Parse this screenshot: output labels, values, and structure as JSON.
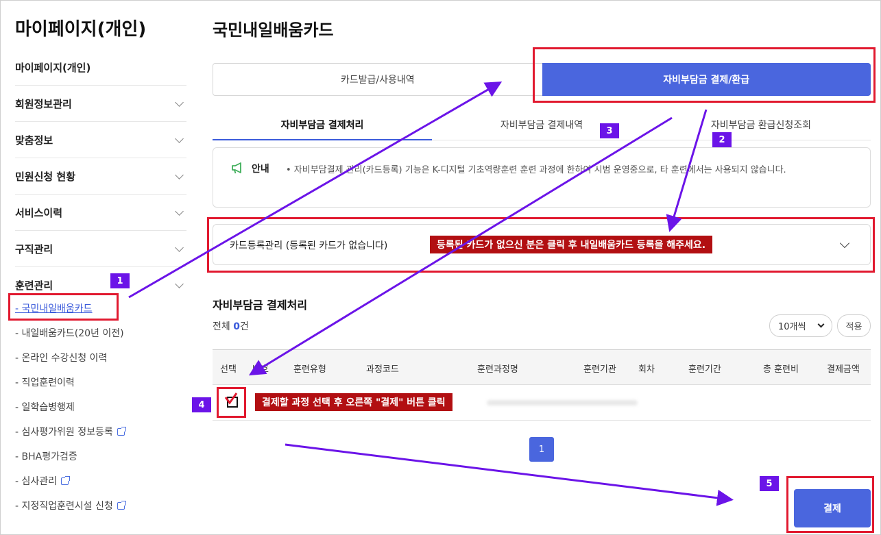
{
  "sidebar": {
    "title": "마이페이지(개인)",
    "items": [
      {
        "label": "마이페이지(개인)",
        "chevron": false
      },
      {
        "label": "회원정보관리",
        "chevron": true
      },
      {
        "label": "맞춤정보",
        "chevron": true
      },
      {
        "label": "민원신청 현황",
        "chevron": true
      },
      {
        "label": "서비스이력",
        "chevron": true
      },
      {
        "label": "구직관리",
        "chevron": true
      },
      {
        "label": "훈련관리",
        "chevron": true
      }
    ],
    "sub_items": [
      {
        "label": "- 국민내일배움카드",
        "active": true,
        "external": false
      },
      {
        "label": "- 내일배움카드(20년 이전)",
        "active": false,
        "external": false
      },
      {
        "label": "- 온라인 수강신청 이력",
        "active": false,
        "external": false
      },
      {
        "label": "- 직업훈련이력",
        "active": false,
        "external": false
      },
      {
        "label": "- 일학습병행제",
        "active": false,
        "external": false
      },
      {
        "label": "- 심사평가위원 정보등록",
        "active": false,
        "external": true
      },
      {
        "label": "- BHA평가검증",
        "active": false,
        "external": false
      },
      {
        "label": "- 심사관리",
        "active": false,
        "external": true
      },
      {
        "label": "- 지정직업훈련시설 신청",
        "active": false,
        "external": true
      }
    ]
  },
  "main": {
    "title": "국민내일배움카드",
    "tabs": [
      {
        "label": "카드발급/사용내역",
        "active": false
      },
      {
        "label": "자비부담금 결제/환급",
        "active": true
      }
    ],
    "subtabs": [
      {
        "label": "자비부담금 결제처리",
        "active": true
      },
      {
        "label": "자비부담금 결제내역",
        "active": false
      },
      {
        "label": "자비부담금 환급신청조회",
        "active": false
      }
    ],
    "notice": {
      "label": "안내",
      "text": "• 자비부담결제 관리(카드등록) 기능은 K-디지털 기초역량훈련 훈련 과정에 한하여 시범 운영중으로, 타 훈련에서는 사용되지 않습니다."
    },
    "card_register": {
      "label": "카드등록관리 (등록된 카드가 없습니다)"
    },
    "section_title": "자비부담금 결제처리",
    "total_prefix": "전체 ",
    "total_count": "0",
    "total_suffix": "건",
    "page_size": "10개씩",
    "apply_label": "적용",
    "table_headers": [
      "선택",
      "번호",
      "훈련유형",
      "과정코드",
      "훈련과정명",
      "훈련기관",
      "회차",
      "훈련기간",
      "총 훈련비",
      "결제금액"
    ],
    "page_number": "1",
    "pay_label": "결제"
  },
  "annotations": {
    "step1": "1",
    "step2": "2",
    "step3": "3",
    "step4": "4",
    "step5": "5",
    "banner_card": "등록된 카드가 없으신 분은 클릭 후 내일배움카드 등록을 해주세요.",
    "banner_select": "결제할 과정 선택 후 오른쪽 \"결제\" 버튼 클릭",
    "red": "#e1192f",
    "purple": "#6b14e8",
    "primary": "#4a66de"
  }
}
